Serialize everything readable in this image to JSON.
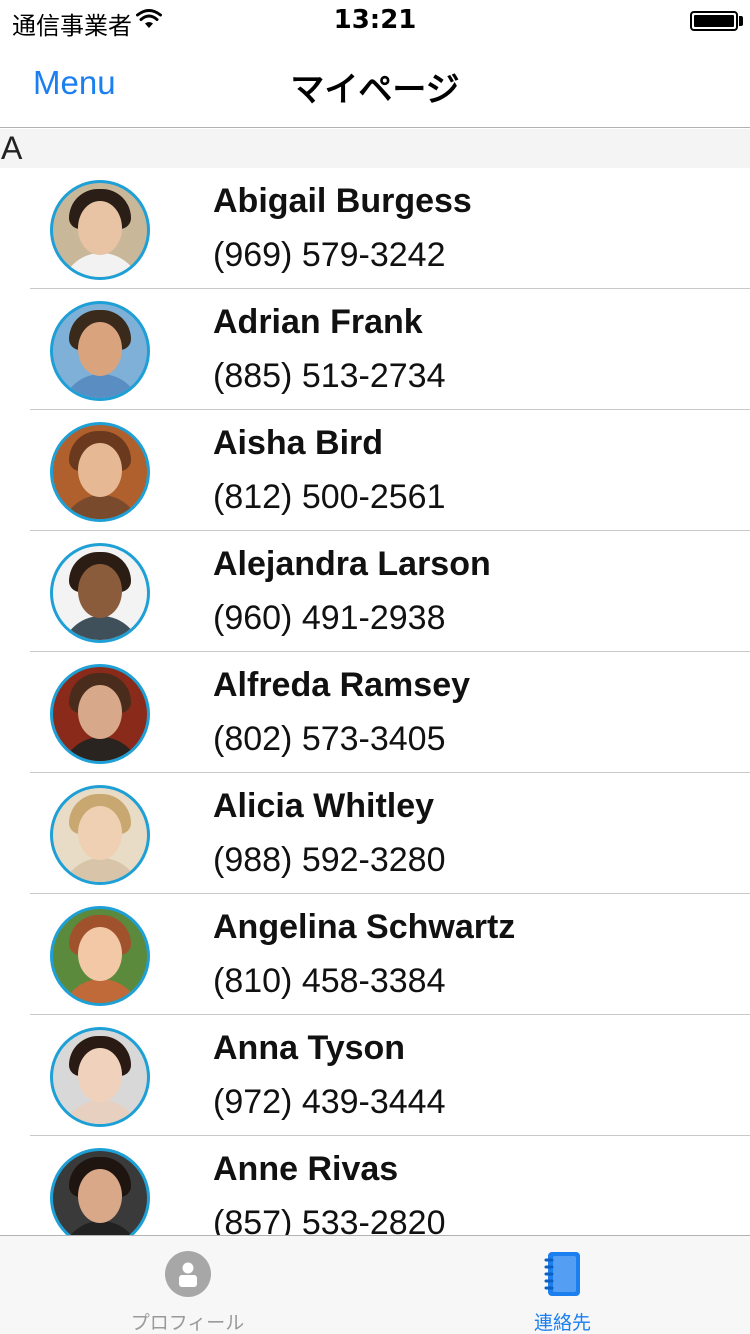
{
  "status_bar": {
    "carrier": "通信事業者",
    "time": "13:21"
  },
  "nav": {
    "menu_label": "Menu",
    "title": "マイページ"
  },
  "section": {
    "letter": "A"
  },
  "contacts": [
    {
      "name": "Abigail Burgess",
      "phone": "(969) 579-3242",
      "skin": "#e8c4a4",
      "hair": "#2a1e16",
      "bg": "#c9b79a",
      "shirt": "#f2f2f2"
    },
    {
      "name": "Adrian Frank",
      "phone": "(885) 513-2734",
      "skin": "#d9a37e",
      "hair": "#3a2a1c",
      "bg": "#7fb0d8",
      "shirt": "#5a8ec2"
    },
    {
      "name": "Aisha Bird",
      "phone": "(812) 500-2561",
      "skin": "#e6b894",
      "hair": "#6b3a1e",
      "bg": "#b0602c",
      "shirt": "#7a4a2c"
    },
    {
      "name": "Alejandra Larson",
      "phone": "(960) 491-2938",
      "skin": "#8a5c3c",
      "hair": "#2b1d14",
      "bg": "#f3f3f3",
      "shirt": "#40505a"
    },
    {
      "name": "Alfreda Ramsey",
      "phone": "(802) 573-3405",
      "skin": "#d7a889",
      "hair": "#4a2c1c",
      "bg": "#8a2a1a",
      "shirt": "#2a2420"
    },
    {
      "name": "Alicia Whitley",
      "phone": "(988) 592-3280",
      "skin": "#f0d0b2",
      "hair": "#c8a870",
      "bg": "#e9dcc6",
      "shirt": "#d8c4a8"
    },
    {
      "name": "Angelina Schwartz",
      "phone": "(810) 458-3384",
      "skin": "#f2c8a6",
      "hair": "#a0522d",
      "bg": "#5c8a3c",
      "shirt": "#c06a3a"
    },
    {
      "name": "Anna Tyson",
      "phone": "(972) 439-3444",
      "skin": "#f0d2bc",
      "hair": "#2a1a14",
      "bg": "#d8d8d8",
      "shirt": "#e8d0c0"
    },
    {
      "name": "Anne Rivas",
      "phone": "(857) 533-2820",
      "skin": "#d8a888",
      "hair": "#1e1410",
      "bg": "#3a3a3a",
      "shirt": "#222222"
    }
  ],
  "tabs": [
    {
      "label": "プロフィール",
      "active": false
    },
    {
      "label": "連絡先",
      "active": true
    }
  ],
  "colors": {
    "accent": "#1b7ff0",
    "avatar_ring": "#1ea0d6",
    "inactive_tab": "#9a9a9a"
  }
}
